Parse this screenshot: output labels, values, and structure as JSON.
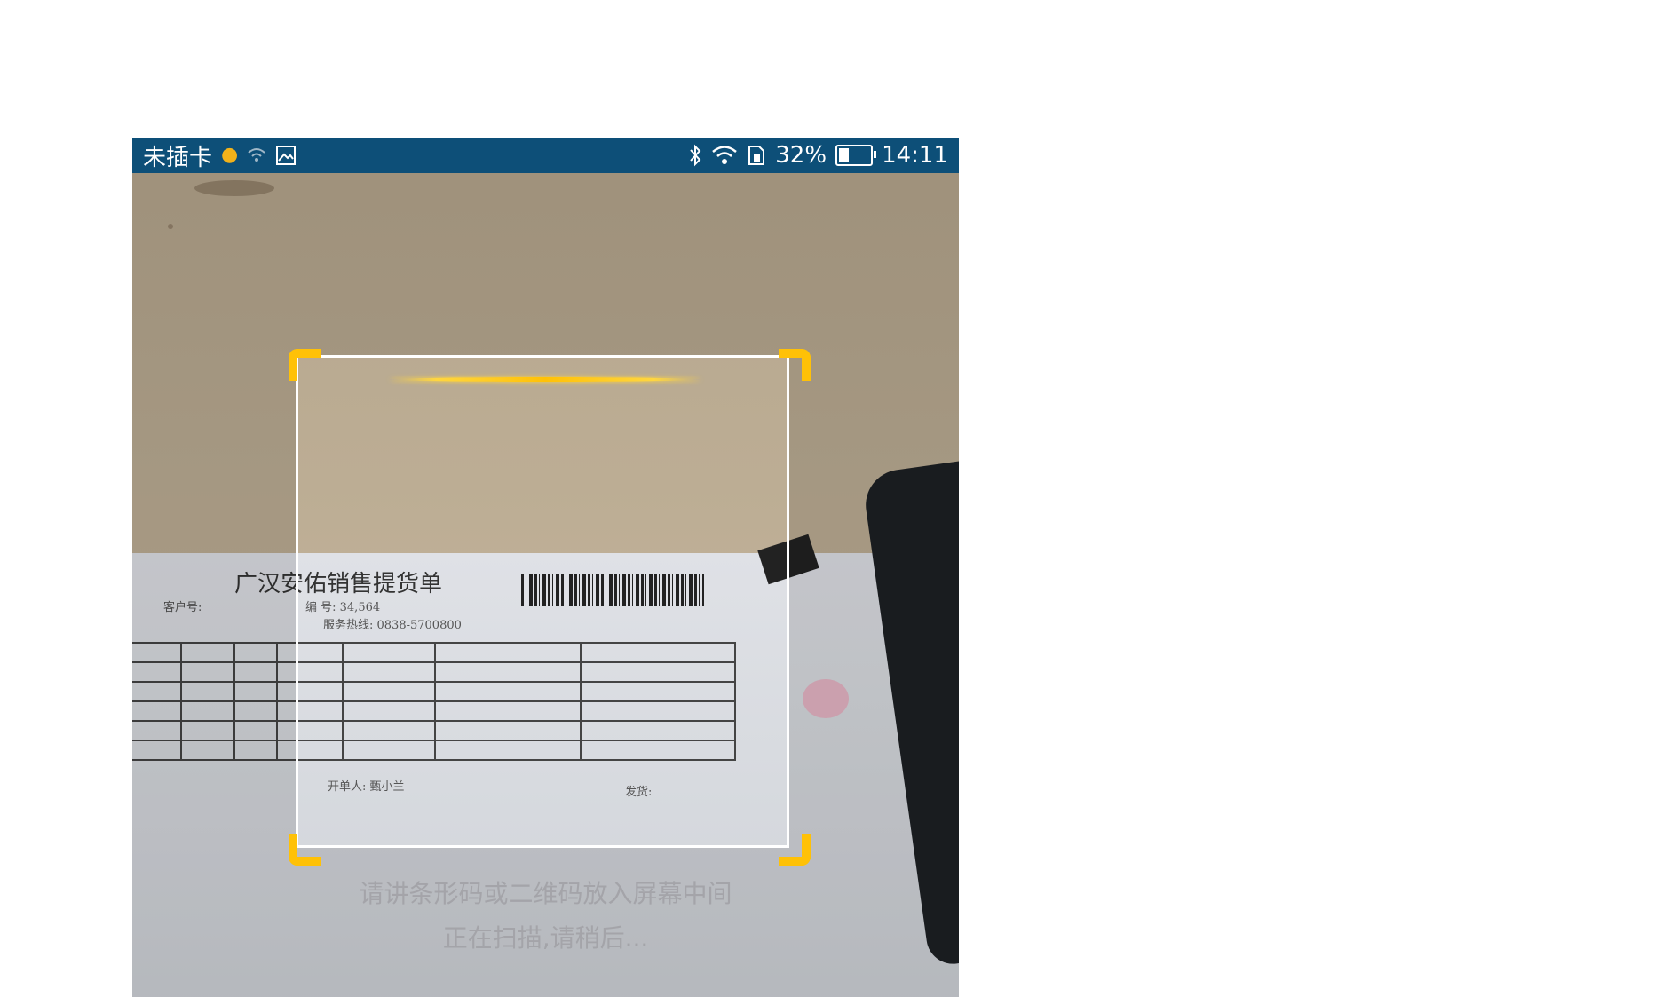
{
  "status_bar": {
    "carrier": "未插卡",
    "battery_percent": "32%",
    "battery_level": 0.32,
    "time": "14:11",
    "icons": [
      "sun-icon",
      "wifi-calling-icon",
      "image-icon",
      "bluetooth-icon",
      "wifi-icon",
      "sim-icon",
      "battery-icon"
    ]
  },
  "document": {
    "title": "广汉安佑销售提货单",
    "customer_label": "客户号:",
    "number_line": "编 号: 34,564",
    "service_line": "服务热线: 0838-5700800",
    "issuer": "开单人: 甄小兰",
    "shipment": "发货:"
  },
  "scanner": {
    "frame_color": "#ffffff",
    "corner_color": "#ffc107",
    "laser_color": "#ffc107",
    "hint_line1": "请讲条形码或二维码放入屏幕中间",
    "hint_line2": "正在扫描,请稍后..."
  }
}
